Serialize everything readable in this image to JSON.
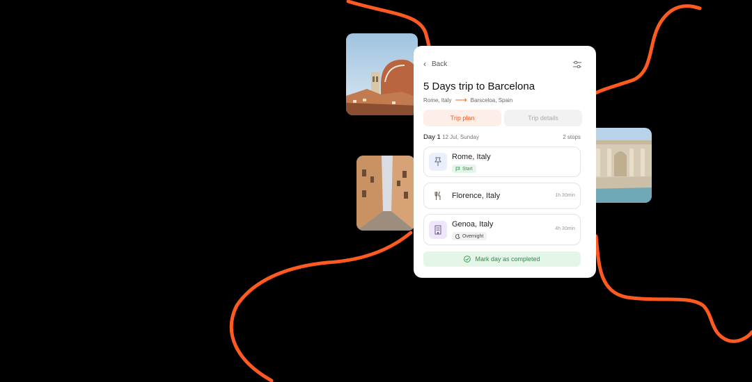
{
  "header": {
    "back_label": "Back",
    "filter_icon": "sliders-icon"
  },
  "trip": {
    "title": "5 Days trip to Barcelona",
    "from": "Rome, Italy",
    "to": "Barsceloa, Spain"
  },
  "tabs": [
    {
      "label": "Trip plan",
      "active": true
    },
    {
      "label": "Trip details",
      "active": false
    }
  ],
  "day": {
    "label": "Day 1",
    "date": "12 Jul, Sunday",
    "stops": "2 stops"
  },
  "stops": [
    {
      "name": "Rome, Italy",
      "icon": "pin-icon",
      "badge": "Start",
      "duration": ""
    },
    {
      "name": "Florence, Italy",
      "icon": "fork-knife-icon",
      "badge": "",
      "duration": "1h 30min"
    },
    {
      "name": "Genoa, Italy",
      "icon": "hotel-icon",
      "badge": "Overnight",
      "duration": "4h 30min"
    }
  ],
  "action": {
    "complete_label": "Mark day as completed"
  },
  "colors": {
    "accent": "#ff5a1f",
    "success": "#2f8a45",
    "background": "#000000"
  }
}
